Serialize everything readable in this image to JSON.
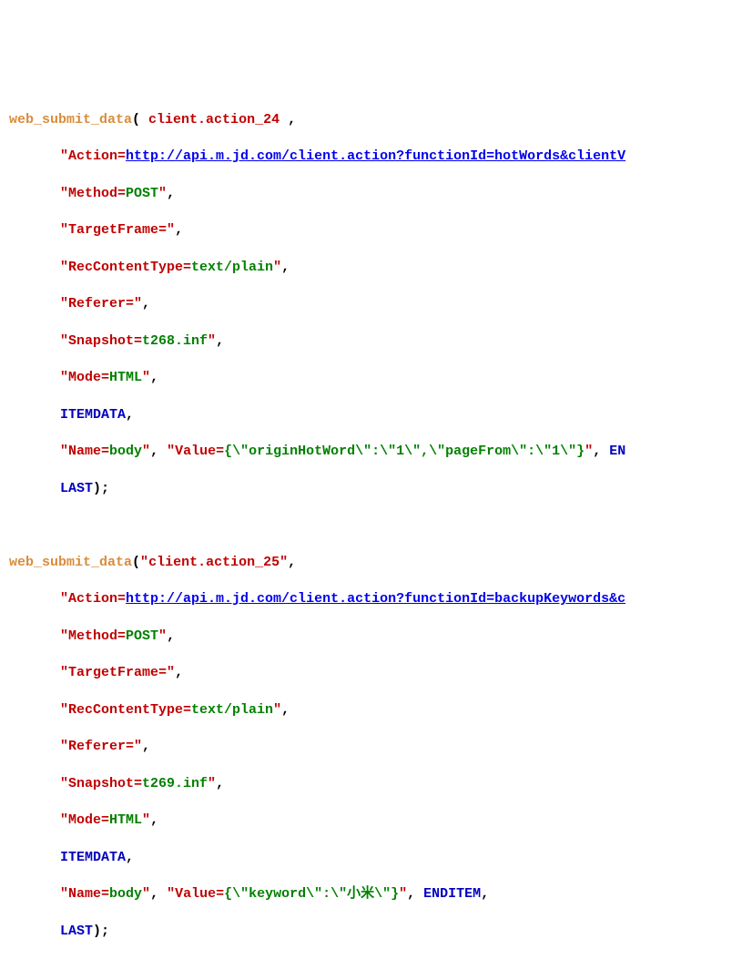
{
  "block1": {
    "fn": "web_submit_data",
    "arg0": "client.action_24",
    "action_key": "Action=",
    "action_url": "http://api.m.jd.com/client.action?functionId=hotWords&clientV",
    "method_key": "Method=",
    "method_val": "POST",
    "tf_key": "TargetFrame=",
    "rct_key": "RecContentType=",
    "rct_val": "text/plain",
    "ref_key": "Referer=",
    "snap_key": "Snapshot=",
    "snap_val": "t268.inf",
    "mode_key": "Mode=",
    "mode_val": "HTML",
    "itemdata": "ITEMDATA",
    "name_key": "Name=",
    "name_val": "body",
    "value_prefix": "Value=",
    "value_body": "{\\\"originHotWord\\\":\\\"1\\\",\\\"pageFrom\\\":\\\"1\\\"}",
    "enditem_trunc": "EN",
    "last": "LAST"
  },
  "block2": {
    "fn": "web_submit_data",
    "arg0": "client.action_25",
    "action_key": "Action=",
    "action_url": "http://api.m.jd.com/client.action?functionId=backupKeywords&c",
    "method_key": "Method=",
    "method_val": "POST",
    "tf_key": "TargetFrame=",
    "rct_key": "RecContentType=",
    "rct_val": "text/plain",
    "ref_key": "Referer=",
    "snap_key": "Snapshot=",
    "snap_val": "t269.inf",
    "mode_key": "Mode=",
    "mode_val": "HTML",
    "itemdata": "ITEMDATA",
    "name_key": "Name=",
    "name_val": "body",
    "value_prefix": "Value=",
    "value_body": "{\\\"keyword\\\":\\\"小米\\\"}",
    "enditem": "ENDITEM",
    "last": "LAST"
  }
}
